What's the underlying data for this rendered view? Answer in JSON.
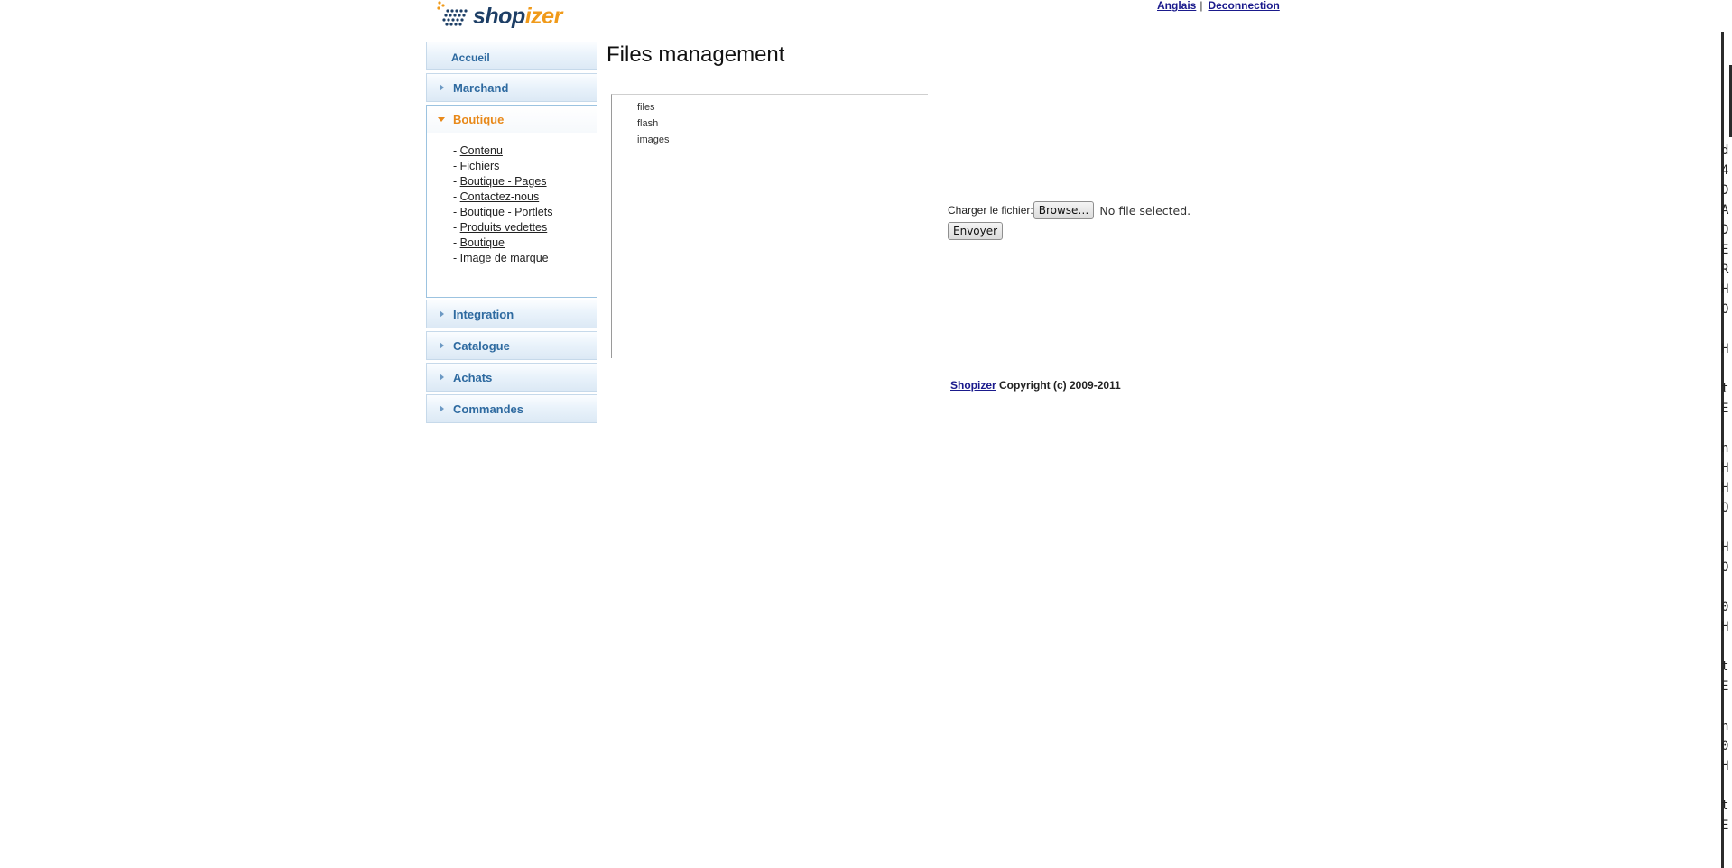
{
  "header": {
    "logo": {
      "part1": "shop",
      "part2": "izer"
    },
    "links": {
      "language": "Anglais",
      "separator": "|",
      "logout": "Deconnection"
    }
  },
  "sidebar": {
    "home": "Accueil",
    "merchant": "Marchand",
    "store": {
      "label": "Boutique",
      "prefix": "- ",
      "items": [
        "Contenu",
        "Fichiers",
        "Boutique - Pages",
        "Contactez-nous",
        "Boutique - Portlets",
        "Produits vedettes",
        "Boutique",
        "Image de marque"
      ]
    },
    "integration": "Integration",
    "catalog": "Catalogue",
    "purchases": "Achats",
    "orders": "Commandes"
  },
  "main": {
    "title": "Files management",
    "tree": [
      "files",
      "flash",
      "images"
    ],
    "upload": {
      "label": "Charger le fichier:",
      "browse": "Browse…",
      "no_file": "No file selected.",
      "submit": "Envoyer"
    }
  },
  "footer": {
    "link": "Shopizer",
    "text": " Copyright (c) 2009-2011"
  },
  "edge_text": "d\n4\nD\nA\nD\nE\nR\nH\nO\n\nH\n\nt\nE\n\nn\nH\nH\nO\n\nH\nO\n\n0\nH\n\nt\nE\n\nn\n0\nH\n\nt\nE"
}
